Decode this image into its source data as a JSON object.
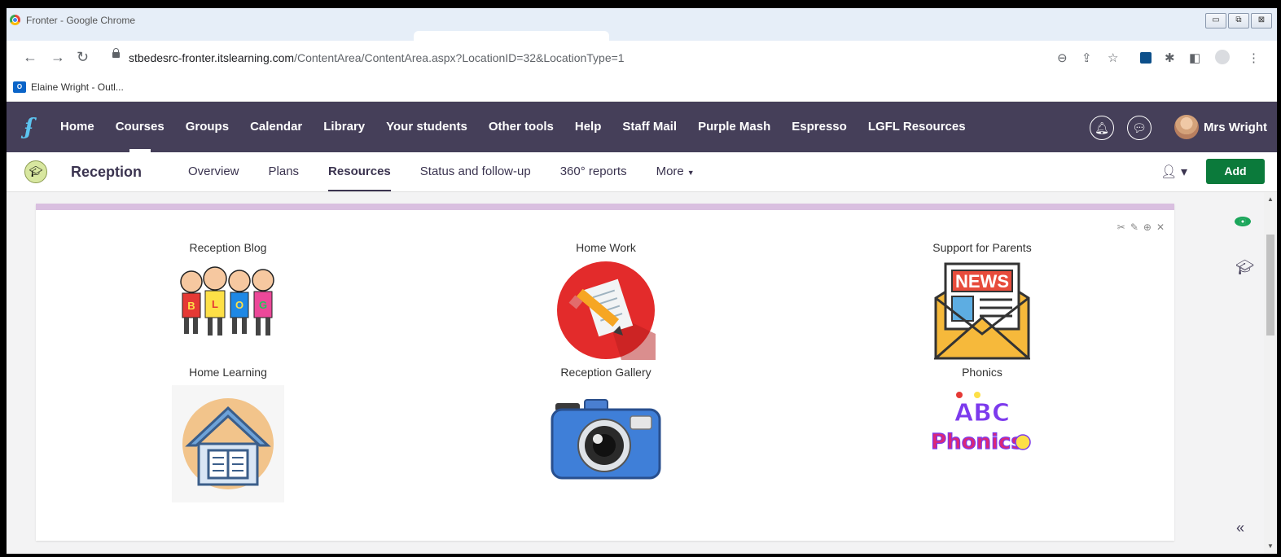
{
  "window": {
    "title": "Fronter - Google Chrome",
    "controls": [
      "▭",
      "⧉",
      "⊠"
    ]
  },
  "browser": {
    "url_host": "stbedesrc-fronter.itslearning.com",
    "url_path": "/ContentArea/ContentArea.aspx?LocationID=32&LocationType=1",
    "bookmark": "Elaine Wright - Outl..."
  },
  "topnav": {
    "items": [
      "Home",
      "Courses",
      "Groups",
      "Calendar",
      "Library",
      "Your students",
      "Other tools",
      "Help",
      "Staff Mail",
      "Purple Mash",
      "Espresso",
      "LGFL Resources"
    ],
    "current_index": 1,
    "user_name": "Mrs Wright"
  },
  "course": {
    "name": "Reception",
    "tabs": [
      "Overview",
      "Plans",
      "Resources",
      "Status and follow-up",
      "360° reports",
      "More"
    ],
    "active_tab": "Resources",
    "add_label": "Add"
  },
  "tiles": [
    {
      "title": "Reception Blog",
      "icon": "blog-kids-icon",
      "blog_letters": [
        "B",
        "L",
        "O",
        "G"
      ]
    },
    {
      "title": "Home Work",
      "icon": "homework-paper-pencil-icon"
    },
    {
      "title": "Support for Parents",
      "icon": "news-envelope-icon",
      "badge": "NEWS"
    },
    {
      "title": "Home Learning",
      "icon": "house-book-icon"
    },
    {
      "title": "Reception Gallery",
      "icon": "camera-icon"
    },
    {
      "title": "Phonics",
      "icon": "abc-phonics-icon",
      "logo_top": "ABC",
      "logo_bottom": "Phonics"
    }
  ],
  "colors": {
    "nav_bg": "#453f59",
    "add_button": "#0b7a3b",
    "card_band": "#d9bfe0",
    "eye_icon": "#1aa55a"
  }
}
